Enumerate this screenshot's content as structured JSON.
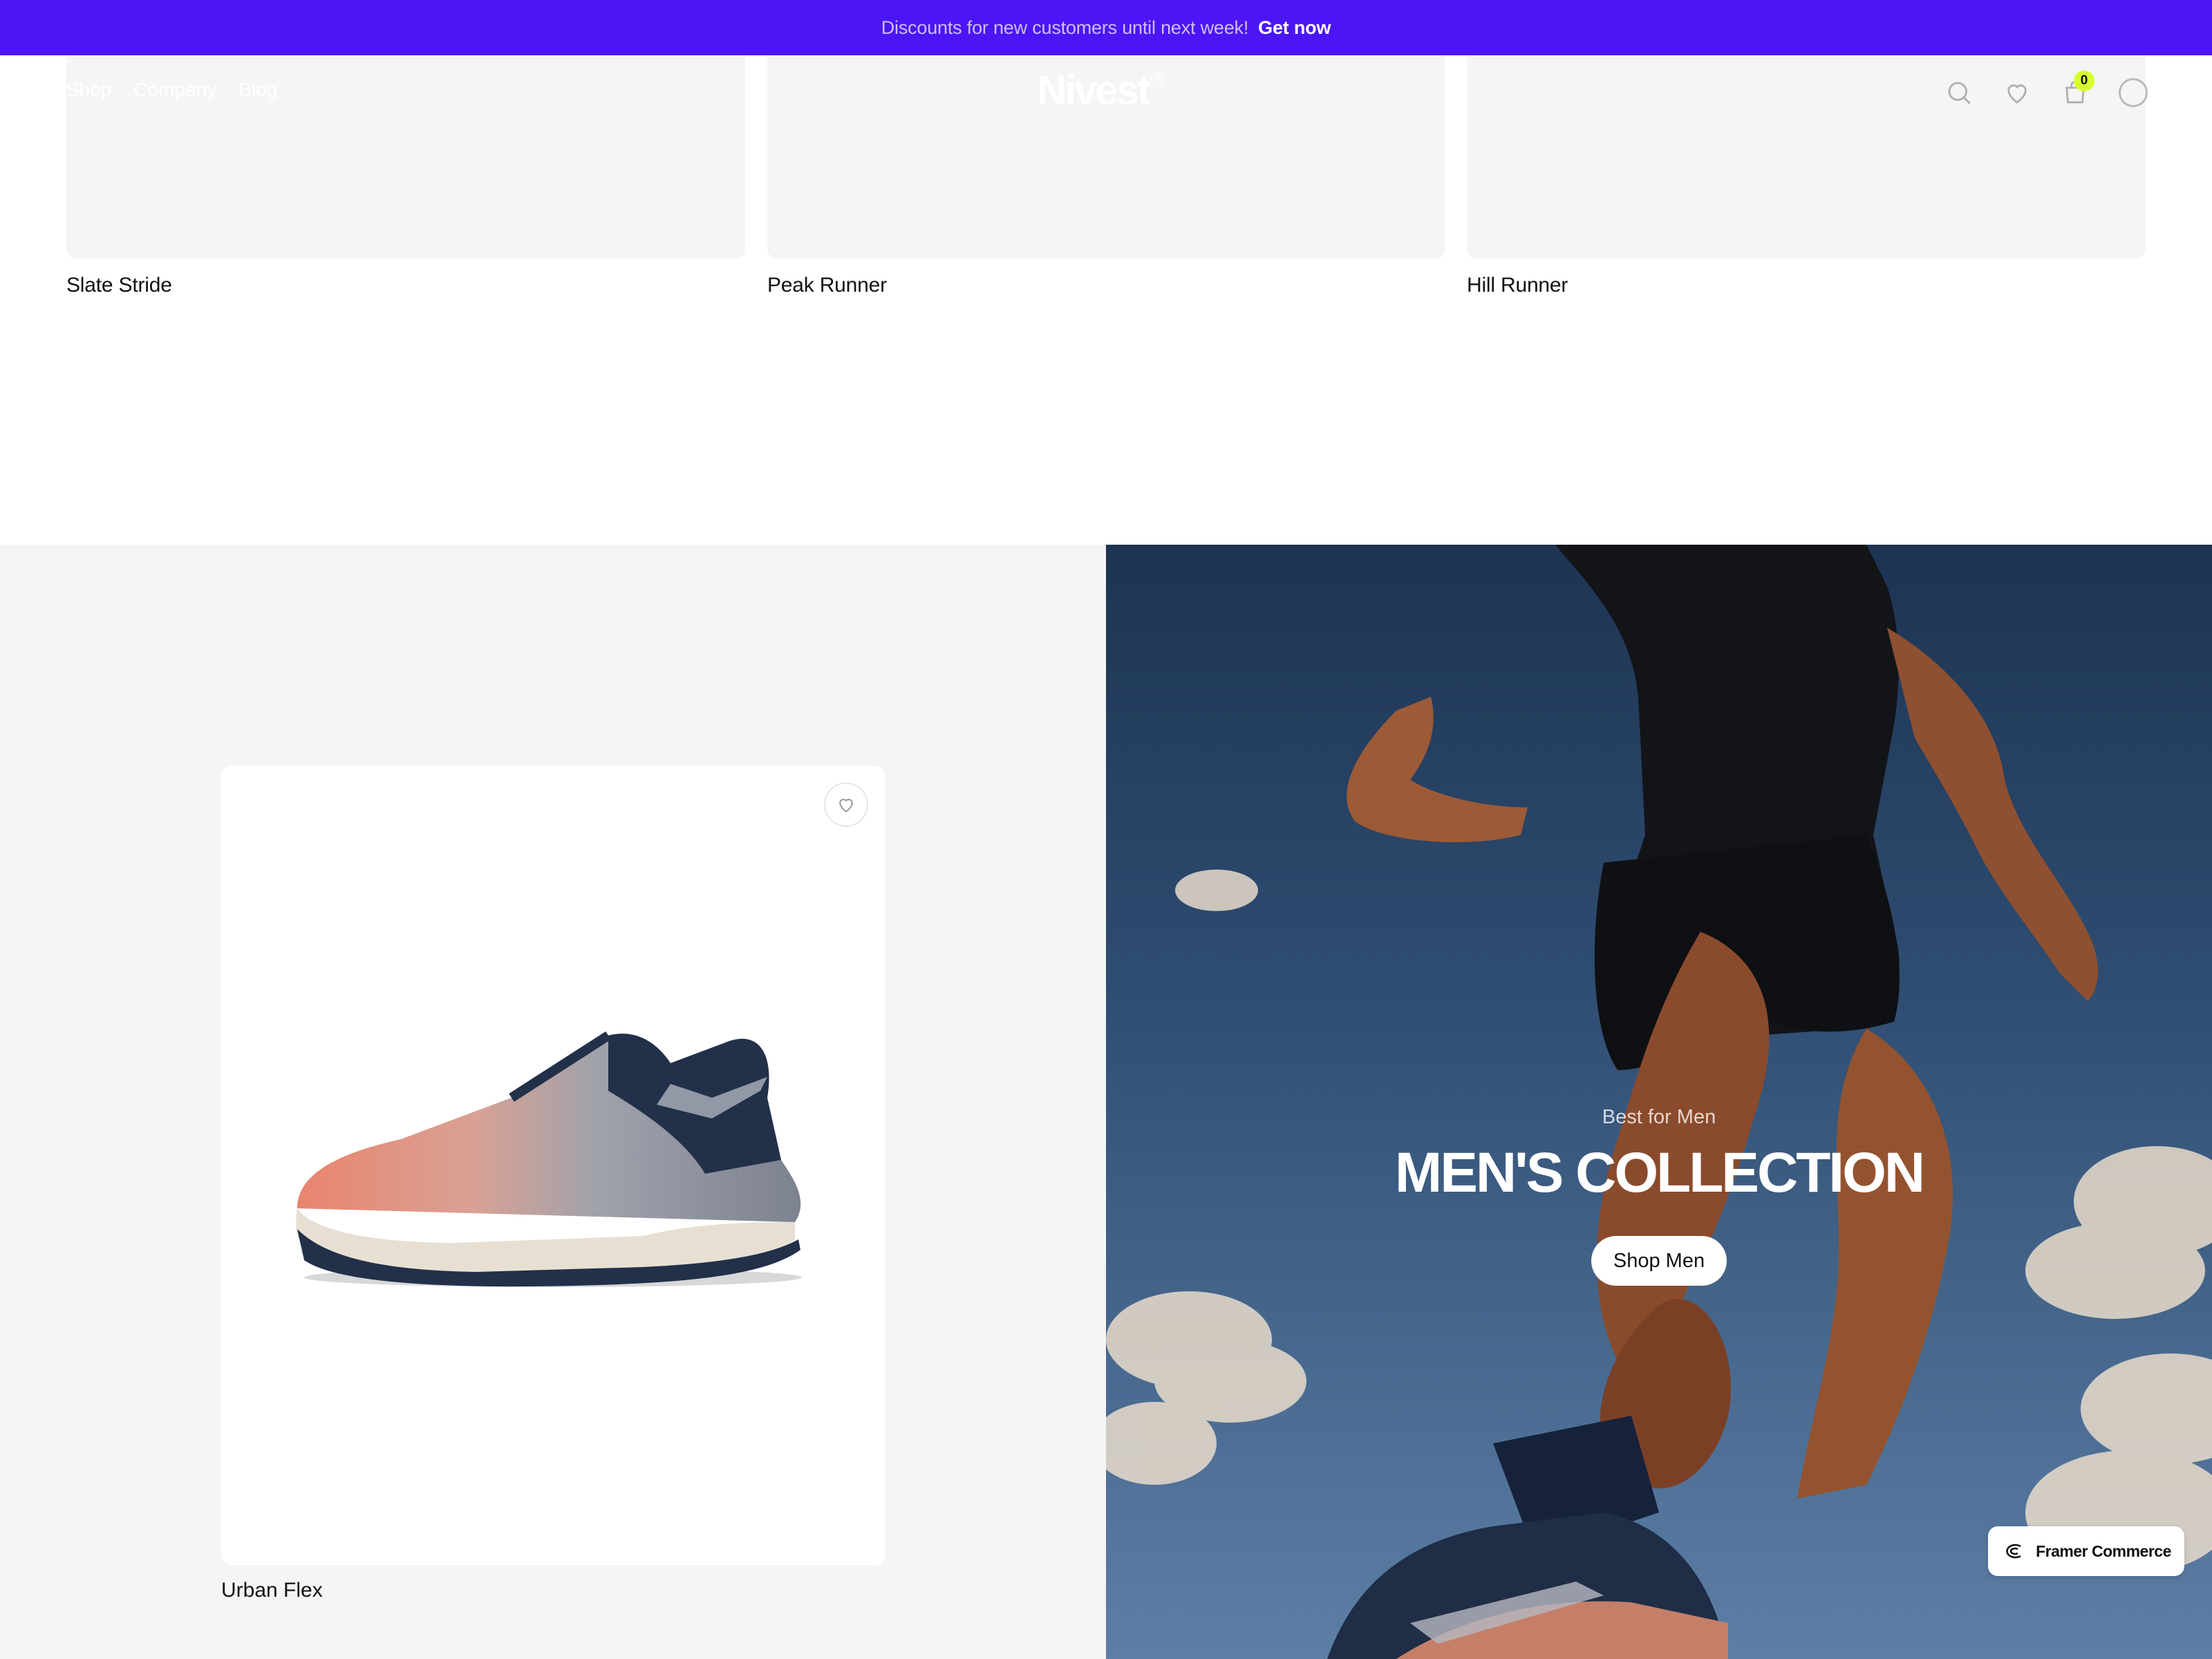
{
  "announcement": {
    "message": "Discounts for new customers until next week!",
    "cta": "Get now"
  },
  "header": {
    "nav": [
      "Shop",
      "Company",
      "Blog"
    ],
    "logo": "Nivest",
    "logo_mark": "®",
    "cart_count": "0",
    "icons": [
      "search-icon",
      "heart-icon",
      "bag-icon",
      "account-icon"
    ]
  },
  "products_top": [
    {
      "name": "Slate Stride"
    },
    {
      "name": "Peak Runner"
    },
    {
      "name": "Hill Runner"
    }
  ],
  "featured_product": {
    "name": "Urban Flex"
  },
  "hero": {
    "kicker": "Best for Men",
    "title": "MEN'S COLLECTION",
    "button": "Shop Men"
  },
  "badge": {
    "label": "Framer Commerce"
  },
  "colors": {
    "announcement_bg": "#4b15f5",
    "cart_badge": "#d7ff2e",
    "panel_bg": "#f5f5f5"
  }
}
